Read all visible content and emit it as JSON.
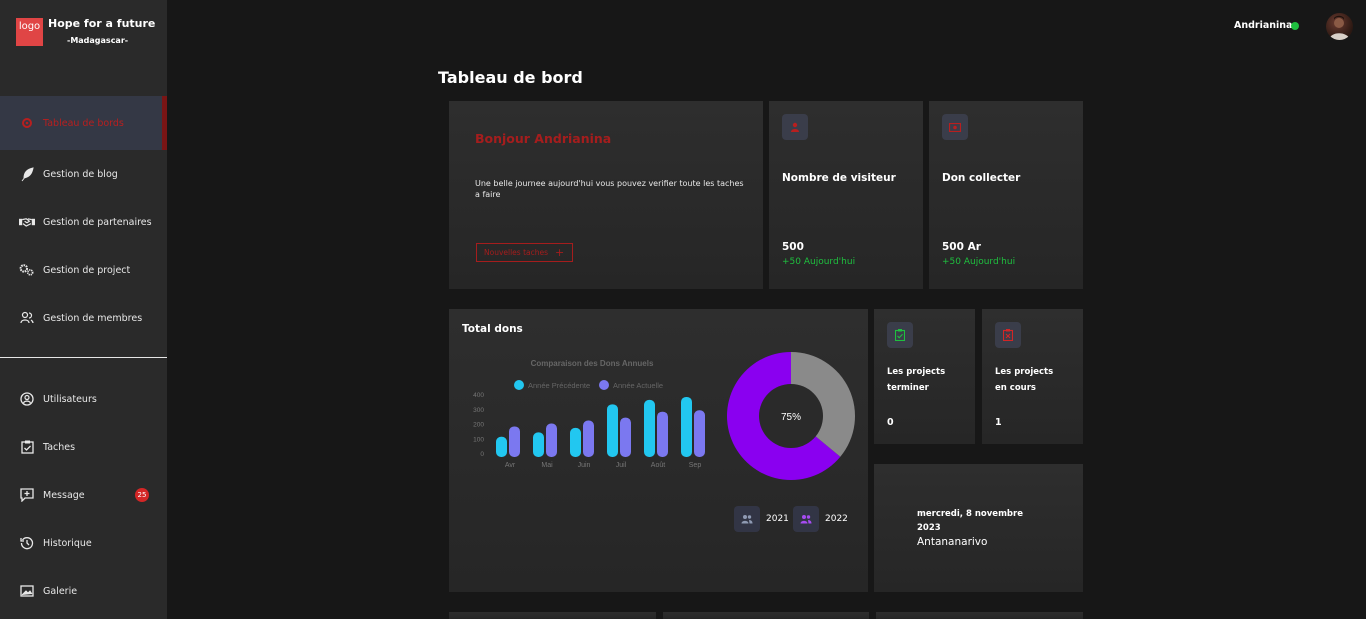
{
  "brand": {
    "logo_text": "logo",
    "name": "Hope for a future",
    "subtitle": "-Madagascar-",
    "accent": "#e04545"
  },
  "sidebar": {
    "items": [
      {
        "label": "Tableau de bords",
        "icon": "gear-icon",
        "active": true
      },
      {
        "label": "Gestion de blog",
        "icon": "feather-icon"
      },
      {
        "label": "Gestion de partenaires",
        "icon": "handshake-icon"
      },
      {
        "label": "Gestion de project",
        "icon": "gears-icon"
      },
      {
        "label": "Gestion de membres",
        "icon": "users-icon"
      }
    ],
    "items2": [
      {
        "label": "Utilisateurs",
        "icon": "user-circle-icon"
      },
      {
        "label": "Taches",
        "icon": "clipboard-check-icon"
      },
      {
        "label": "Message",
        "icon": "message-plus-icon",
        "badge": "25"
      },
      {
        "label": "Historique",
        "icon": "history-icon"
      },
      {
        "label": "Galerie",
        "icon": "image-icon"
      }
    ]
  },
  "header": {
    "user": "Andrianina",
    "status_color": "#1fbf3f"
  },
  "page": {
    "title": "Tableau de bord"
  },
  "welcome": {
    "greeting": "Bonjour Andrianina",
    "text": "Une belle journee aujourd'hui vous pouvez verifier toute les taches a faire",
    "button": "Nouvelles taches"
  },
  "visitors": {
    "title": "Nombre de visiteur",
    "value": "500",
    "delta": "+50 Aujourd'hui",
    "icon": "user-icon"
  },
  "donations": {
    "title": "Don collecter",
    "value": "500 Ar",
    "delta": "+50 Aujourd'hui",
    "icon": "money-icon"
  },
  "total": {
    "title": "Total dons",
    "legend_2021": "2021",
    "legend_2022": "2022"
  },
  "projects_done": {
    "line1": "Les projects",
    "line2": "terminer",
    "value": "0",
    "icon": "clipboard-check-icon"
  },
  "projects_ongoing": {
    "line1": "Les projects",
    "line2": "en cours",
    "value": "1",
    "icon": "clipboard-x-icon"
  },
  "date_card": {
    "date_line1": "mercredi, 8 novembre",
    "date_line2": "2023",
    "city": "Antananarivo"
  },
  "chart_data": [
    {
      "type": "bar",
      "title": "Comparaison des Dons Annuels",
      "categories": [
        "Avr",
        "Mai",
        "Juin",
        "Juil",
        "Août",
        "Sep"
      ],
      "series": [
        {
          "name": "Année Précédente",
          "color": "#22c7f0",
          "values": [
            110,
            140,
            170,
            330,
            360,
            380
          ]
        },
        {
          "name": "Année Actuelle",
          "color": "#7b78f0",
          "values": [
            180,
            200,
            220,
            240,
            280,
            290
          ]
        }
      ],
      "yticks": [
        "400",
        "300",
        "200",
        "100",
        "0"
      ],
      "ylim": [
        0,
        400
      ],
      "legend": "top"
    },
    {
      "type": "pie",
      "label": "75%",
      "values": [
        64,
        36
      ],
      "colors": [
        "#8a00f0",
        "#8a8a8a"
      ]
    }
  ]
}
